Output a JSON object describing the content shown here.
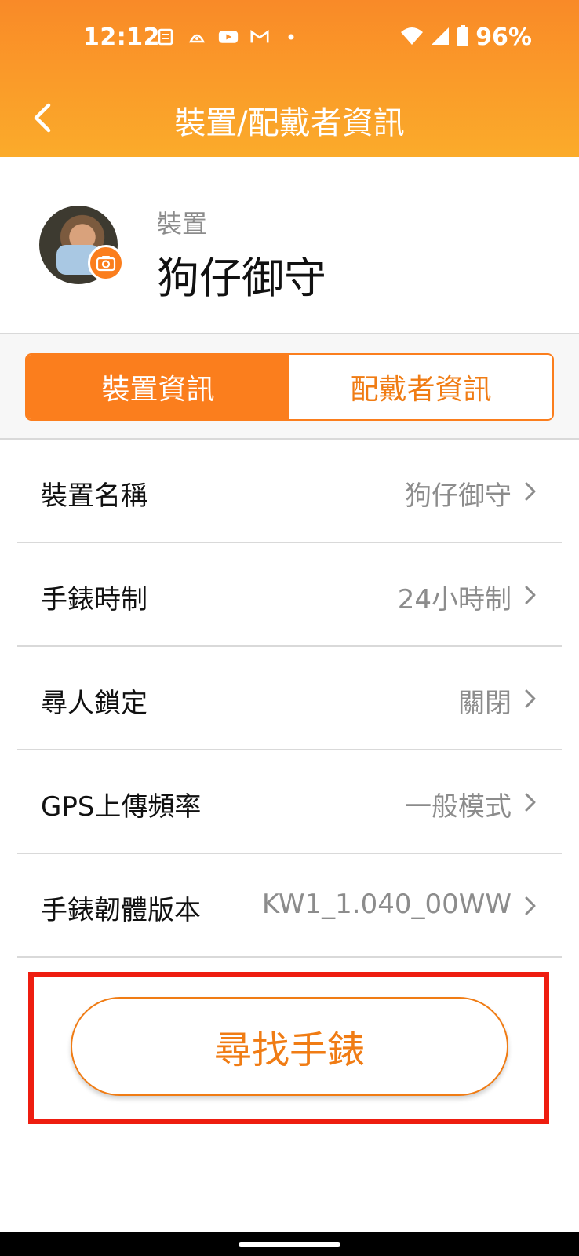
{
  "status_bar": {
    "time": "12:12",
    "battery": "96%",
    "left_icons": [
      "document-icon",
      "app-icon",
      "youtube-icon",
      "gmail-icon",
      "dot-icon"
    ],
    "right_icons": [
      "wifi-icon",
      "signal-icon",
      "battery-icon"
    ]
  },
  "header": {
    "title": "裝置/配戴者資訊"
  },
  "profile": {
    "subtitle": "裝置",
    "name": "狗仔御守"
  },
  "tabs": [
    {
      "label": "裝置資訊",
      "active": true
    },
    {
      "label": "配戴者資訊",
      "active": false
    }
  ],
  "rows": [
    {
      "label": "裝置名稱",
      "value": "狗仔御守"
    },
    {
      "label": "手錶時制",
      "value": "24小時制"
    },
    {
      "label": "尋人鎖定",
      "value": "關閉"
    },
    {
      "label": "GPS上傳頻率",
      "value": "一般模式"
    },
    {
      "label": "手錶韌體版本",
      "value": "KW1_1.040_00WW"
    }
  ],
  "find_button": {
    "label": "尋找手錶"
  },
  "colors": {
    "accent": "#fb7e1d",
    "header_top": "#f98a28",
    "header_bottom": "#fbab2a",
    "highlight": "#ee1d10"
  }
}
